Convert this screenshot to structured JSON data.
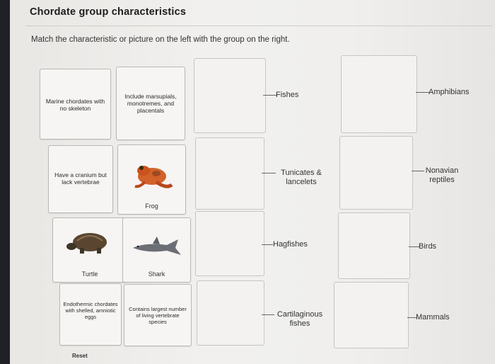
{
  "title": "Chordate group characteristics",
  "instructions": "Match the characteristic or picture on the left with the group on the right.",
  "cards": {
    "c1": "Marine chordates with no skeleton",
    "c2": "Include marsupials, monotremes, and placentals",
    "c3": "Have a cranium but lack vertebrae",
    "c4": "Frog",
    "c5": "Turtle",
    "c6": "Shark",
    "c7": "Endothermic chordates with shelled, amniotic eggs",
    "c8": "Contains largest number of living vertebrate species"
  },
  "groups": {
    "g1": "Fishes",
    "g2": "Amphibians",
    "g3": "Tunicates & lancelets",
    "g4": "Nonavian reptiles",
    "g5": "Hagfishes",
    "g6": "Birds",
    "g7": "Cartilaginous fishes",
    "g8": "Mammals"
  },
  "reset_label": "Reset",
  "icons": [
    "frog-image",
    "turtle-image",
    "shark-image"
  ]
}
